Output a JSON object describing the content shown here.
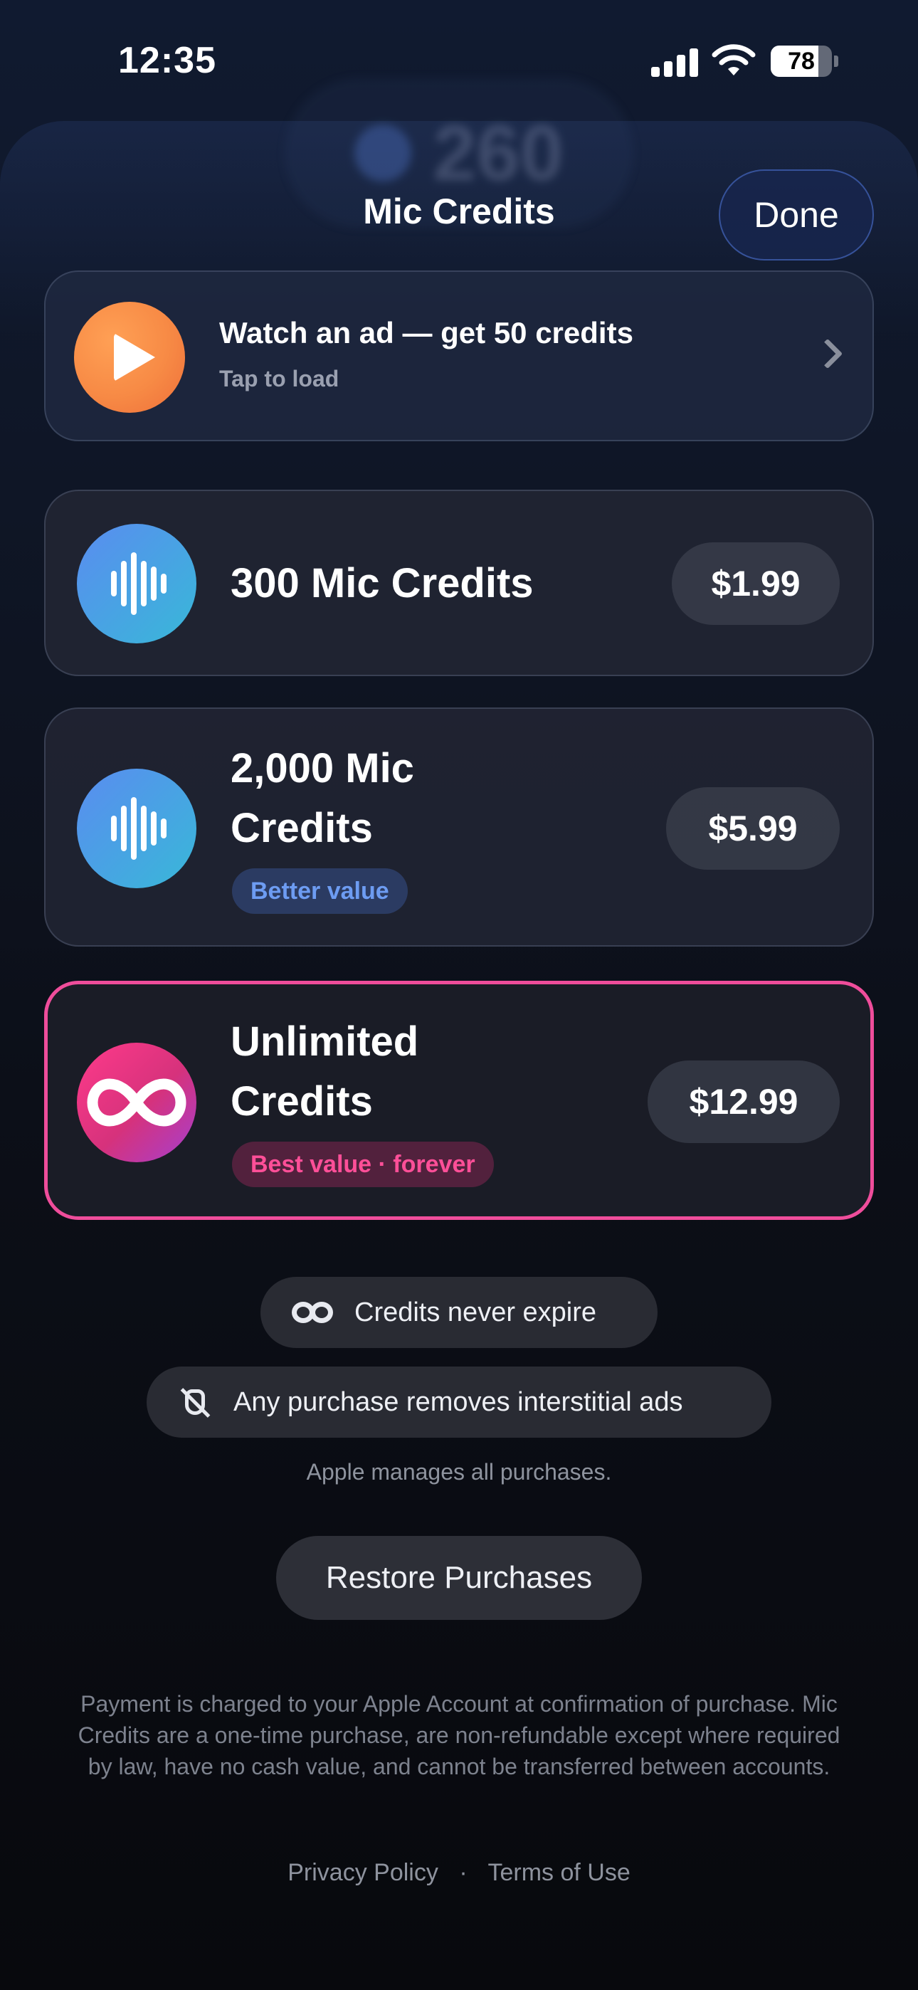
{
  "status_bar": {
    "time": "12:35",
    "battery": "78"
  },
  "background": {
    "balance": "260"
  },
  "header": {
    "title": "Mic Credits",
    "done_label": "Done"
  },
  "ad_offer": {
    "title": "Watch an ad — get 50 credits",
    "subtitle": "Tap to load",
    "icon": "play-icon"
  },
  "products": [
    {
      "name": "300 Mic Credits",
      "price": "$1.99",
      "badge": "",
      "icon": "waveform-icon"
    },
    {
      "name_line1": "2,000 Mic",
      "name_line2": "Credits",
      "price": "$5.99",
      "badge": "Better value",
      "icon": "waveform-icon"
    },
    {
      "name_line1": "Unlimited",
      "name_line2": "Credits",
      "price": "$12.99",
      "badge": "Best value · forever",
      "icon": "infinity-icon"
    }
  ],
  "info": {
    "expire": "Credits never expire",
    "ads": "Any purchase removes interstitial ads",
    "apple_note": "Apple manages all purchases."
  },
  "restore_label": "Restore Purchases",
  "legal_text": "Payment is charged to your Apple Account at confirmation of purchase. Mic Credits are a one-time purchase, are non-refundable except where required by law, have no cash value, and cannot be transferred between accounts.",
  "footer": {
    "privacy": "Privacy Policy",
    "separator": "·",
    "terms": "Terms of Use"
  },
  "colors": {
    "accent_pink": "#ef4d9b",
    "accent_blue": "#5a8cf0",
    "ad_orange": "#f78a45"
  }
}
